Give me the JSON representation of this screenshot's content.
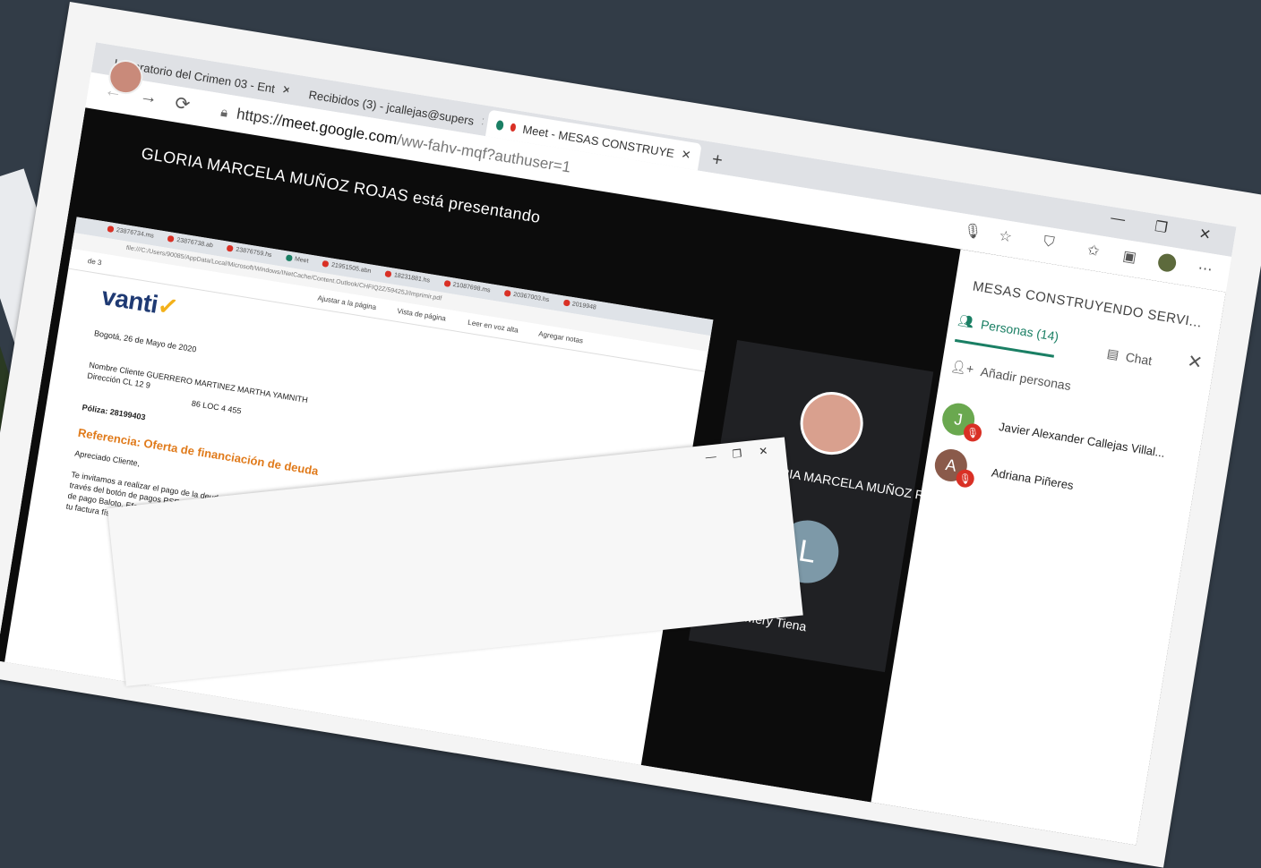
{
  "browser": {
    "tabs": [
      {
        "label": "Laboratorio del Crimen 03 - Ent",
        "favicon": "youtube-icon",
        "color": "#e62117"
      },
      {
        "label": "Recibidos (3) - jcallejas@supers",
        "favicon": "gmail-icon",
        "color": "#d93025"
      },
      {
        "label": "Meet - MESAS CONSTRUYE",
        "favicon": "meet-icon",
        "color": "#1a7f64"
      }
    ],
    "close_glyph": "✕",
    "new_tab": "+",
    "url_scheme": "https://",
    "url_host": "meet.google.com",
    "url_path": "/ww-fahv-mqf?authuser=1",
    "window_controls": [
      "—",
      "❐",
      "✕"
    ]
  },
  "meet": {
    "presenting_text": "GLORIA MARCELA MUÑOZ ROJAS está presentando",
    "participant_tiles": [
      {
        "name": "GLORIA MARCELA MUÑOZ R..."
      },
      {
        "name": "Luz Mery Tiena",
        "initial": "L"
      }
    ],
    "panel": {
      "title": "MESAS CONSTRUYENDO SERVI...",
      "tab_people": "Personas (14)",
      "tab_chat": "Chat",
      "add_people": "Añadir personas",
      "people": [
        {
          "initial": "J",
          "name": "Javier Alexander Callejas Villal...",
          "color": "#6aa84f"
        },
        {
          "initial": "A",
          "name": "Adriana Piñeres",
          "color": "#8a5a4a"
        }
      ]
    }
  },
  "shared_screen": {
    "tabs": [
      "23876734.ms",
      "23876738.ab",
      "23876759.hs",
      "Meet",
      "21951505.abn",
      "18231881.hs",
      "21087698.ms",
      "20367003.hs",
      "2019948"
    ],
    "url": "file:///C:/Users/90085/AppData/Local/Microsoft/Windows/INetCache/Content.Outlook/CHFIQ2Z/59425J/Imprimir.pdf",
    "toolbar": [
      "Ajustar a la página",
      "Vista de página",
      "Leer en voz alta",
      "Agregar notas"
    ],
    "page_number": "de 3",
    "doc": {
      "logo": "vanti",
      "date": "Bogotá, 26 de Mayo de 2020",
      "client_line": "Nombre Cliente GUERRERO MARTINEZ MARTHA YAMNITH",
      "address_line": "Dirección CL 12 9",
      "address_line2": "86   LOC 4   455",
      "policy": "Póliza: 28199403",
      "reference": "Referencia: Oferta de financiación de deuda",
      "greeting": "Apreciado Cliente,",
      "body_1": "Te invitamos a realizar el pago de la deuda de tu ...",
      "body_2": "través del botón de pagos PSE que encuentras ...",
      "body_3": "de pago Baloto, Efecty, Jueves ...",
      "body_4": "tu factura física."
    }
  }
}
